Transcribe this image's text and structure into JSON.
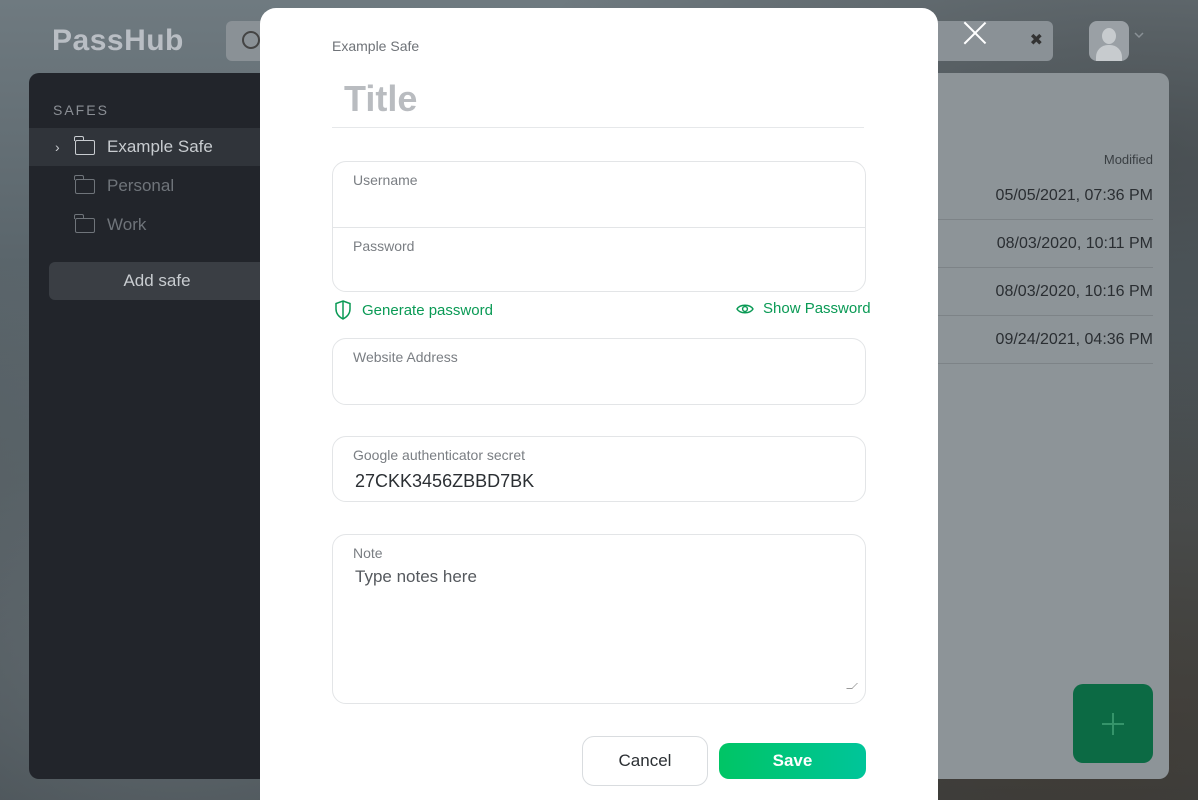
{
  "app": {
    "logo": "PassHub"
  },
  "sidebar": {
    "section_label": "SAFES",
    "safes": [
      {
        "label": "Example Safe",
        "active": true
      },
      {
        "label": "Personal",
        "active": false
      },
      {
        "label": "Work",
        "active": false
      }
    ],
    "add_safe_label": "Add safe"
  },
  "list": {
    "modified_header": "Modified",
    "rows": [
      "05/05/2021, 07:36 PM",
      "08/03/2020, 10:11 PM",
      "08/03/2020, 10:16 PM",
      "09/24/2021, 04:36 PM"
    ]
  },
  "modal": {
    "safe_name": "Example Safe",
    "title_placeholder": "Title",
    "username_label": "Username",
    "password_label": "Password",
    "generate_password_label": "Generate password",
    "show_password_label": "Show Password",
    "website_label": "Website Address",
    "totp_label": "Google authenticator secret",
    "totp_value": "27CKK3456ZBBD7BK",
    "note_label": "Note",
    "note_placeholder": "Type notes here",
    "cancel_label": "Cancel",
    "save_label": "Save"
  },
  "colors": {
    "accent": "#0a9a55",
    "save_gradient_start": "#00c565",
    "save_gradient_end": "#00c59a",
    "sidebar_bg": "#22252b"
  },
  "icons": [
    "search-icon",
    "clear-icon",
    "avatar-icon",
    "chevron-down-icon",
    "chevron-right-icon",
    "folder-icon",
    "close-icon",
    "shield-icon",
    "eye-icon",
    "plus-icon"
  ]
}
